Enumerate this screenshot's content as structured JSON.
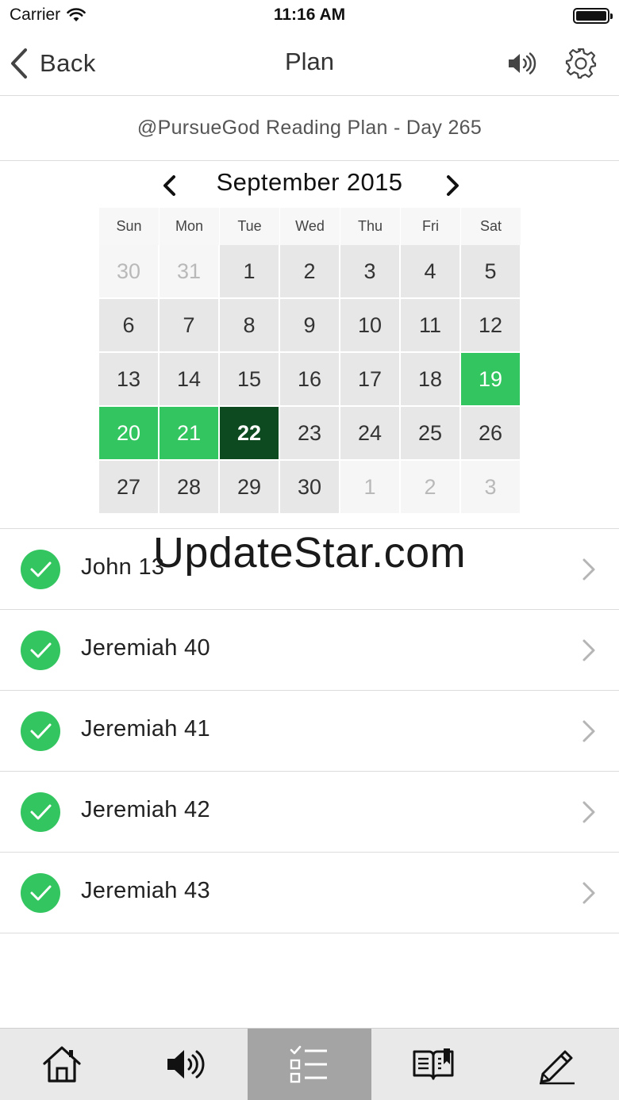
{
  "status_bar": {
    "carrier": "Carrier",
    "time": "11:16 AM"
  },
  "nav": {
    "back_label": "Back",
    "title": "Plan"
  },
  "plan_header": "@PursueGod Reading Plan - Day 265",
  "calendar": {
    "month_title": "September 2015",
    "weekdays": [
      "Sun",
      "Mon",
      "Tue",
      "Wed",
      "Thu",
      "Fri",
      "Sat"
    ],
    "days": [
      {
        "label": "30",
        "state": "outside"
      },
      {
        "label": "31",
        "state": "outside"
      },
      {
        "label": "1",
        "state": "normal"
      },
      {
        "label": "2",
        "state": "normal"
      },
      {
        "label": "3",
        "state": "normal"
      },
      {
        "label": "4",
        "state": "normal"
      },
      {
        "label": "5",
        "state": "normal"
      },
      {
        "label": "6",
        "state": "normal"
      },
      {
        "label": "7",
        "state": "normal"
      },
      {
        "label": "8",
        "state": "normal"
      },
      {
        "label": "9",
        "state": "normal"
      },
      {
        "label": "10",
        "state": "normal"
      },
      {
        "label": "11",
        "state": "normal"
      },
      {
        "label": "12",
        "state": "normal"
      },
      {
        "label": "13",
        "state": "normal"
      },
      {
        "label": "14",
        "state": "normal"
      },
      {
        "label": "15",
        "state": "normal"
      },
      {
        "label": "16",
        "state": "normal"
      },
      {
        "label": "17",
        "state": "normal"
      },
      {
        "label": "18",
        "state": "normal"
      },
      {
        "label": "19",
        "state": "done"
      },
      {
        "label": "20",
        "state": "done"
      },
      {
        "label": "21",
        "state": "done"
      },
      {
        "label": "22",
        "state": "today"
      },
      {
        "label": "23",
        "state": "normal"
      },
      {
        "label": "24",
        "state": "normal"
      },
      {
        "label": "25",
        "state": "normal"
      },
      {
        "label": "26",
        "state": "normal"
      },
      {
        "label": "27",
        "state": "normal"
      },
      {
        "label": "28",
        "state": "normal"
      },
      {
        "label": "29",
        "state": "normal"
      },
      {
        "label": "30",
        "state": "normal"
      },
      {
        "label": "1",
        "state": "outside"
      },
      {
        "label": "2",
        "state": "outside"
      },
      {
        "label": "3",
        "state": "outside"
      }
    ]
  },
  "readings": [
    {
      "label": "John 13",
      "completed": true
    },
    {
      "label": "Jeremiah 40",
      "completed": true
    },
    {
      "label": "Jeremiah 41",
      "completed": true
    },
    {
      "label": "Jeremiah 42",
      "completed": true
    },
    {
      "label": "Jeremiah 43",
      "completed": true
    }
  ],
  "watermark": "UpdateStar.com",
  "tabs": [
    {
      "icon": "home-icon",
      "active": false
    },
    {
      "icon": "speaker-icon",
      "active": false
    },
    {
      "icon": "checklist-icon",
      "active": true
    },
    {
      "icon": "book-icon",
      "active": false
    },
    {
      "icon": "pencil-icon",
      "active": false
    }
  ],
  "colors": {
    "completed_green": "#33c55f",
    "today_dark_green": "#0d4a20",
    "day_gray": "#e7e7e7",
    "active_tab": "#a4a4a4"
  }
}
